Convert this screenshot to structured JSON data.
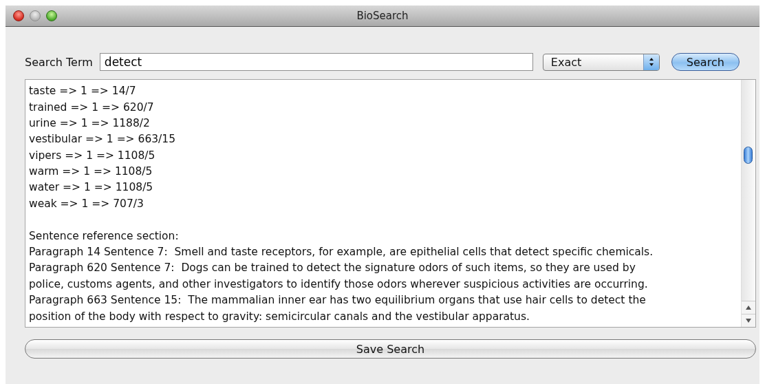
{
  "window": {
    "title": "BioSearch"
  },
  "search": {
    "label": "Search Term",
    "value": "detect"
  },
  "match_mode": {
    "value": "Exact"
  },
  "search_button": {
    "label": "Search"
  },
  "results": {
    "index_lines": [
      "taste => 1 => 14/7",
      "trained => 1 => 620/7",
      "urine => 1 => 1188/2",
      "vestibular => 1 => 663/15",
      "vipers => 1 => 1108/5",
      "warm => 1 => 1108/5",
      "water => 1 => 1108/5",
      "weak => 1 => 707/3"
    ],
    "reference_heading": "Sentence reference section:",
    "reference_lines": [
      "Paragraph 14 Sentence 7:  Smell and taste receptors, for example, are epithelial cells that detect specific chemicals.",
      "Paragraph 620 Sentence 7:  Dogs can be trained to detect the signature odors of such items, so they are used by",
      "police, customs agents, and other investigators to identify those odors wherever suspicious activities are occurring.",
      "Paragraph 663 Sentence 15:  The mammalian inner ear has two equilibrium organs that use hair cells to detect the",
      "position of the body with respect to gravity: semicircular canals and the vestibular apparatus."
    ]
  },
  "save_button": {
    "label": "Save Search"
  }
}
